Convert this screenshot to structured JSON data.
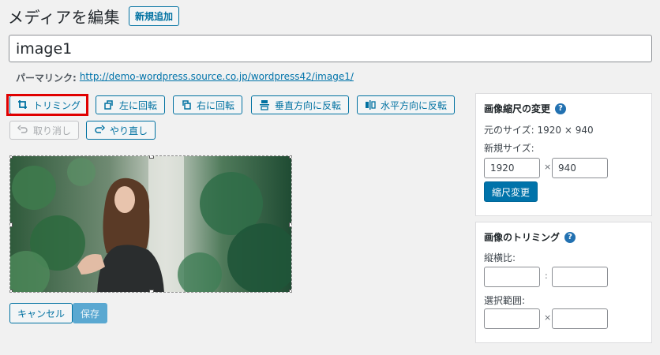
{
  "header": {
    "title": "メディアを編集",
    "add_new_label": "新規追加"
  },
  "title_field": {
    "value": "image1"
  },
  "permalink": {
    "label": "パーマリンク:",
    "url": "http://demo-wordpress.source.co.jp/wordpress42/image1/"
  },
  "toolbar": {
    "crop": "トリミング",
    "rotate_left": "左に回転",
    "rotate_right": "右に回転",
    "flip_vertical": "垂直方向に反転",
    "flip_horizontal": "水平方向に反転",
    "undo": "取り消し",
    "redo": "やり直し"
  },
  "actions": {
    "cancel": "キャンセル",
    "save": "保存"
  },
  "scale_panel": {
    "title": "画像縮尺の変更",
    "original_size": "元のサイズ: 1920 × 940",
    "new_size_label": "新規サイズ:",
    "width": "1920",
    "times": "×",
    "height": "940",
    "scale_button": "縮尺変更"
  },
  "crop_panel": {
    "title": "画像のトリミング",
    "aspect_label": "縦横比:",
    "aspect_sep": ":",
    "selection_label": "選択範囲:",
    "selection_sep": "×"
  },
  "colors": {
    "accent": "#0071a1",
    "primary": "#0073aa",
    "highlight": "#e00000"
  },
  "icons": [
    "crop-icon",
    "rotate-left-icon",
    "rotate-right-icon",
    "flip-vertical-icon",
    "flip-horizontal-icon",
    "undo-icon",
    "redo-icon",
    "help-icon"
  ]
}
